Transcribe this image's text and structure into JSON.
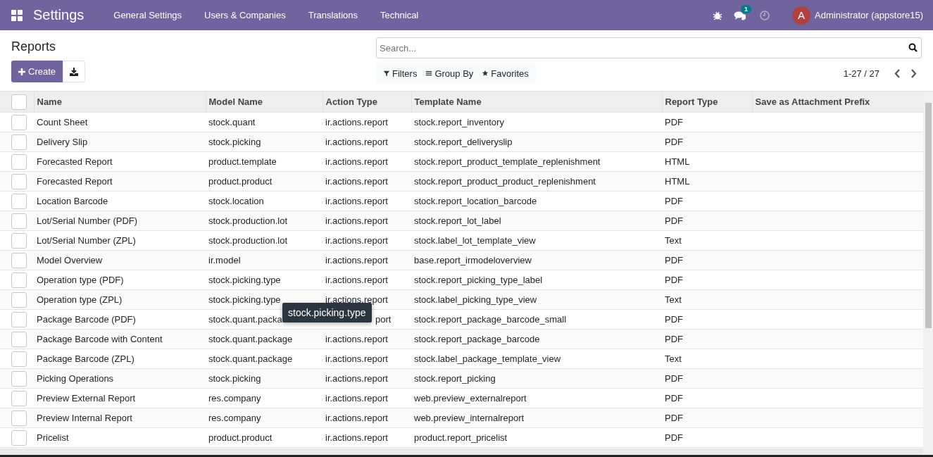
{
  "navbar": {
    "app_title": "Settings",
    "menu": [
      "General Settings",
      "Users & Companies",
      "Translations",
      "Technical"
    ],
    "message_count": "1",
    "user_initial": "A",
    "user_name": "Administrator (appstore15)"
  },
  "control_panel": {
    "title": "Reports",
    "create_label": "Create",
    "search": {
      "placeholder": "Search..."
    },
    "filters": [
      "Filters",
      "Group By",
      "Favorites"
    ],
    "pager": "1-27 / 27"
  },
  "table": {
    "select_all_checked": false,
    "columns": [
      "Name",
      "Model Name",
      "Action Type",
      "Template Name",
      "Report Type",
      "Save as Attachment Prefix"
    ],
    "rows": [
      {
        "name": "Count Sheet",
        "model": "stock.quant",
        "action_type": "ir.actions.report",
        "template": "stock.report_inventory",
        "report_type": "PDF",
        "selected": false
      },
      {
        "name": "Delivery Slip",
        "model": "stock.picking",
        "action_type": "ir.actions.report",
        "template": "stock.report_deliveryslip",
        "report_type": "PDF",
        "selected": false
      },
      {
        "name": "Forecasted Report",
        "model": "product.template",
        "action_type": "ir.actions.report",
        "template": "stock.report_product_template_replenishment",
        "report_type": "HTML",
        "selected": false
      },
      {
        "name": "Forecasted Report",
        "model": "product.product",
        "action_type": "ir.actions.report",
        "template": "stock.report_product_product_replenishment",
        "report_type": "HTML",
        "selected": false
      },
      {
        "name": "Location Barcode",
        "model": "stock.location",
        "action_type": "ir.actions.report",
        "template": "stock.report_location_barcode",
        "report_type": "PDF",
        "selected": false
      },
      {
        "name": "Lot/Serial Number (PDF)",
        "model": "stock.production.lot",
        "action_type": "ir.actions.report",
        "template": "stock.report_lot_label",
        "report_type": "PDF",
        "selected": false
      },
      {
        "name": "Lot/Serial Number (ZPL)",
        "model": "stock.production.lot",
        "action_type": "ir.actions.report",
        "template": "stock.label_lot_template_view",
        "report_type": "Text",
        "selected": false
      },
      {
        "name": "Model Overview",
        "model": "ir.model",
        "action_type": "ir.actions.report",
        "template": "base.report_irmodeloverview",
        "report_type": "PDF",
        "selected": false
      },
      {
        "name": "Operation type (PDF)",
        "model": "stock.picking.type",
        "action_type": "ir.actions.report",
        "template": "stock.report_picking_type_label",
        "report_type": "PDF",
        "selected": false
      },
      {
        "name": "Operation type (ZPL)",
        "model": "stock.picking.type",
        "action_type": "ir.actions.report",
        "template": "stock.label_picking_type_view",
        "report_type": "Text",
        "selected": false
      },
      {
        "name": "Package Barcode (PDF)",
        "model": "stock.quant.packa",
        "action_type": "port",
        "template": "stock.report_package_barcode_small",
        "report_type": "PDF",
        "selected": false,
        "covered": true
      },
      {
        "name": "Package Barcode with Content",
        "model": "stock.quant.package",
        "action_type": "ir.actions.report",
        "template": "stock.report_package_barcode",
        "report_type": "PDF",
        "selected": false
      },
      {
        "name": "Package Barcode (ZPL)",
        "model": "stock.quant.package",
        "action_type": "ir.actions.report",
        "template": "stock.label_package_template_view",
        "report_type": "Text",
        "selected": false
      },
      {
        "name": "Picking Operations",
        "model": "stock.picking",
        "action_type": "ir.actions.report",
        "template": "stock.report_picking",
        "report_type": "PDF",
        "selected": false
      },
      {
        "name": "Preview External Report",
        "model": "res.company",
        "action_type": "ir.actions.report",
        "template": "web.preview_externalreport",
        "report_type": "PDF",
        "selected": false
      },
      {
        "name": "Preview Internal Report",
        "model": "res.company",
        "action_type": "ir.actions.report",
        "template": "web.preview_internalreport",
        "report_type": "PDF",
        "selected": false
      },
      {
        "name": "Pricelist",
        "model": "product.product",
        "action_type": "ir.actions.report",
        "template": "product.report_pricelist",
        "report_type": "PDF",
        "selected": false
      }
    ]
  },
  "tooltip": {
    "text": "stock.picking.type"
  }
}
